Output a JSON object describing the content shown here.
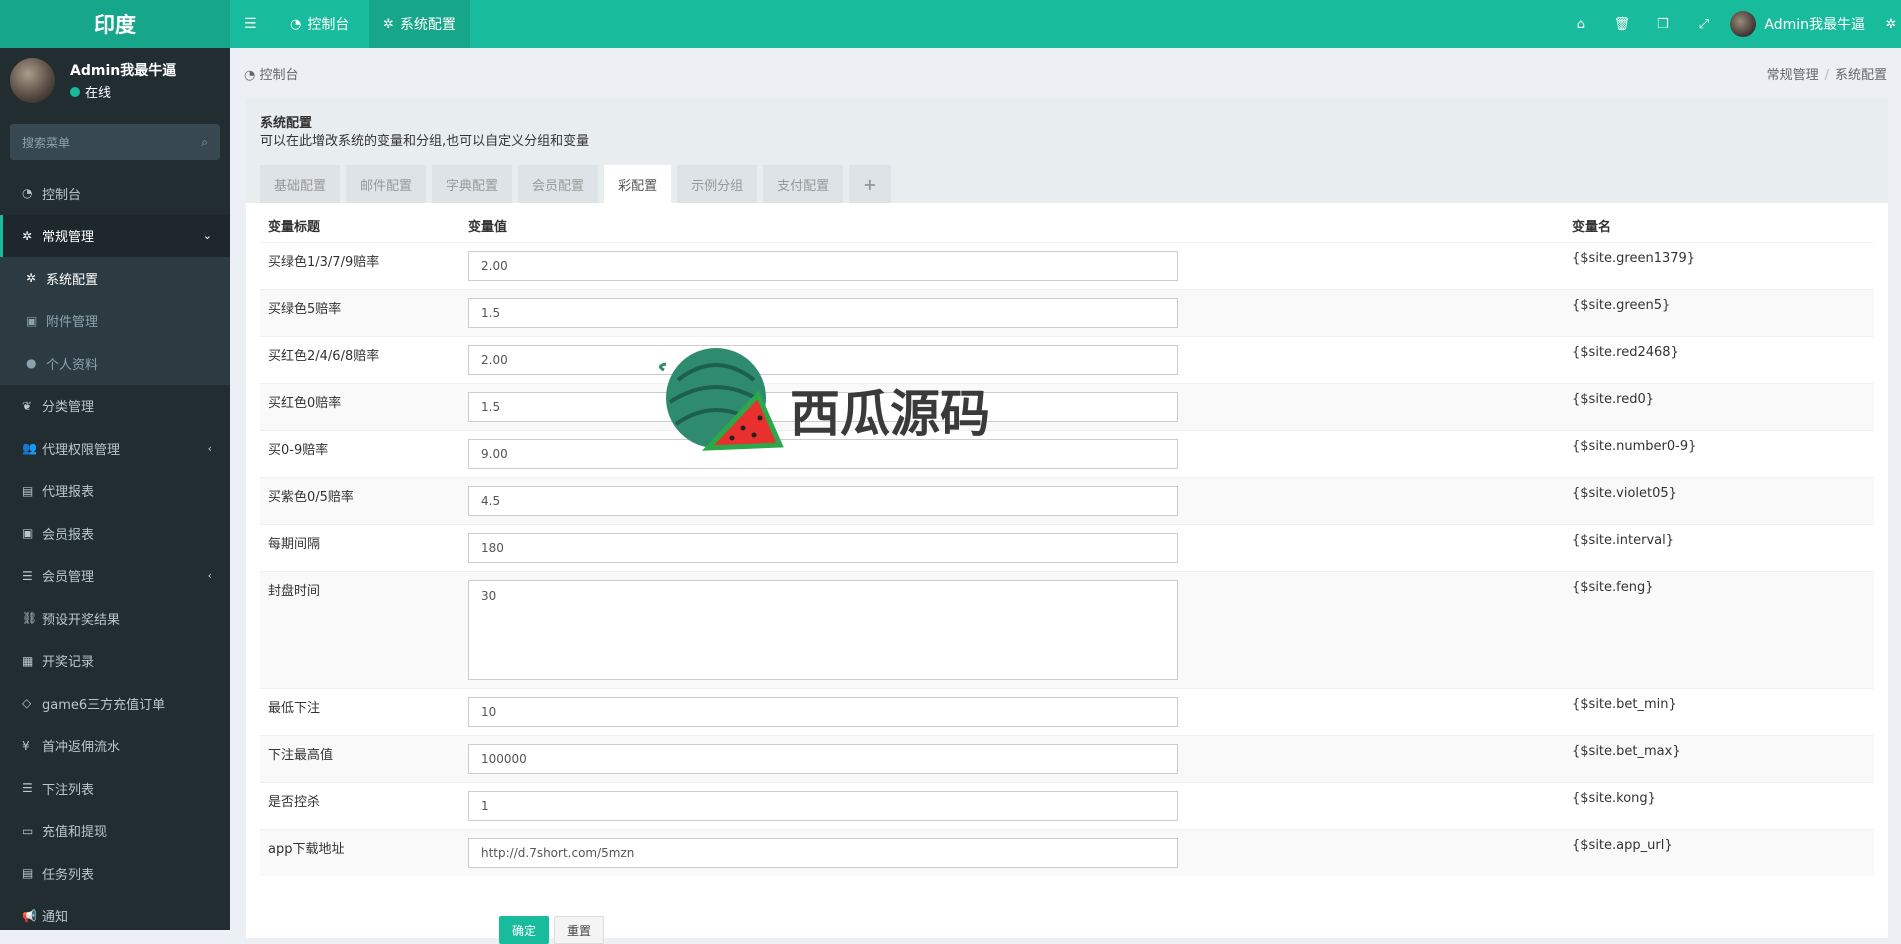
{
  "brand": "印度",
  "topnav": {
    "menu_toggle_icon": "bars-icon",
    "tabs": [
      {
        "label": "控制台",
        "icon": "dashboard-icon"
      },
      {
        "label": "系统配置",
        "icon": "gear-icon"
      }
    ],
    "right_icons": [
      "home-icon",
      "trash-icon",
      "copy-icon",
      "fullscreen-icon",
      "gear-icon"
    ],
    "user_name": "Admin我最牛逼"
  },
  "sidebar": {
    "user_name": "Admin我最牛逼",
    "status": "在线",
    "search_placeholder": "搜索菜单",
    "items": [
      {
        "label": "控制台"
      },
      {
        "label": "常规管理"
      },
      {
        "label": "系统配置"
      },
      {
        "label": "附件管理"
      },
      {
        "label": "个人资料"
      },
      {
        "label": "分类管理"
      },
      {
        "label": "代理权限管理"
      },
      {
        "label": "代理报表"
      },
      {
        "label": "会员报表"
      },
      {
        "label": "会员管理"
      },
      {
        "label": "预设开奖结果"
      },
      {
        "label": "开奖记录"
      },
      {
        "label": "game6三方充值订单"
      },
      {
        "label": "首冲返佣流水"
      },
      {
        "label": "下注列表"
      },
      {
        "label": "充值和提现"
      },
      {
        "label": "任务列表"
      },
      {
        "label": "通知"
      }
    ]
  },
  "breadcrumb": {
    "left": "控制台",
    "right_1": "常规管理",
    "right_2": "系统配置"
  },
  "panel": {
    "title": "系统配置",
    "description": "可以在此增改系统的变量和分组,也可以自定义分组和变量",
    "tabs": [
      "基础配置",
      "邮件配置",
      "字典配置",
      "会员配置",
      "彩配置",
      "示例分组",
      "支付配置",
      "+"
    ],
    "active_tab": "彩配置"
  },
  "table": {
    "headers": {
      "title": "变量标题",
      "value": "变量值",
      "name": "变量名"
    },
    "rows": [
      {
        "title": "买绿色1/3/7/9赔率",
        "value": "2.00",
        "name": "{$site.green1379}"
      },
      {
        "title": "买绿色5赔率",
        "value": "1.5",
        "name": "{$site.green5}"
      },
      {
        "title": "买红色2/4/6/8赔率",
        "value": "2.00",
        "name": "{$site.red2468}"
      },
      {
        "title": "买红色0赔率",
        "value": "1.5",
        "name": "{$site.red0}"
      },
      {
        "title": "买0-9赔率",
        "value": "9.00",
        "name": "{$site.number0-9}"
      },
      {
        "title": "买紫色0/5赔率",
        "value": "4.5",
        "name": "{$site.violet05}"
      },
      {
        "title": "每期间隔",
        "value": "180",
        "name": "{$site.interval}"
      },
      {
        "title": "封盘时间",
        "value": "30",
        "name": "{$site.feng}"
      },
      {
        "title": "最低下注",
        "value": "10",
        "name": "{$site.bet_min}"
      },
      {
        "title": "下注最高值",
        "value": "100000",
        "name": "{$site.bet_max}"
      },
      {
        "title": "是否控杀",
        "value": "1",
        "name": "{$site.kong}"
      },
      {
        "title": "app下载地址",
        "value": "http://d.7short.com/5mzn",
        "name": "{$site.app_url}"
      }
    ]
  },
  "buttons": {
    "ok": "确定",
    "reset": "重置"
  },
  "watermark": "西瓜源码"
}
